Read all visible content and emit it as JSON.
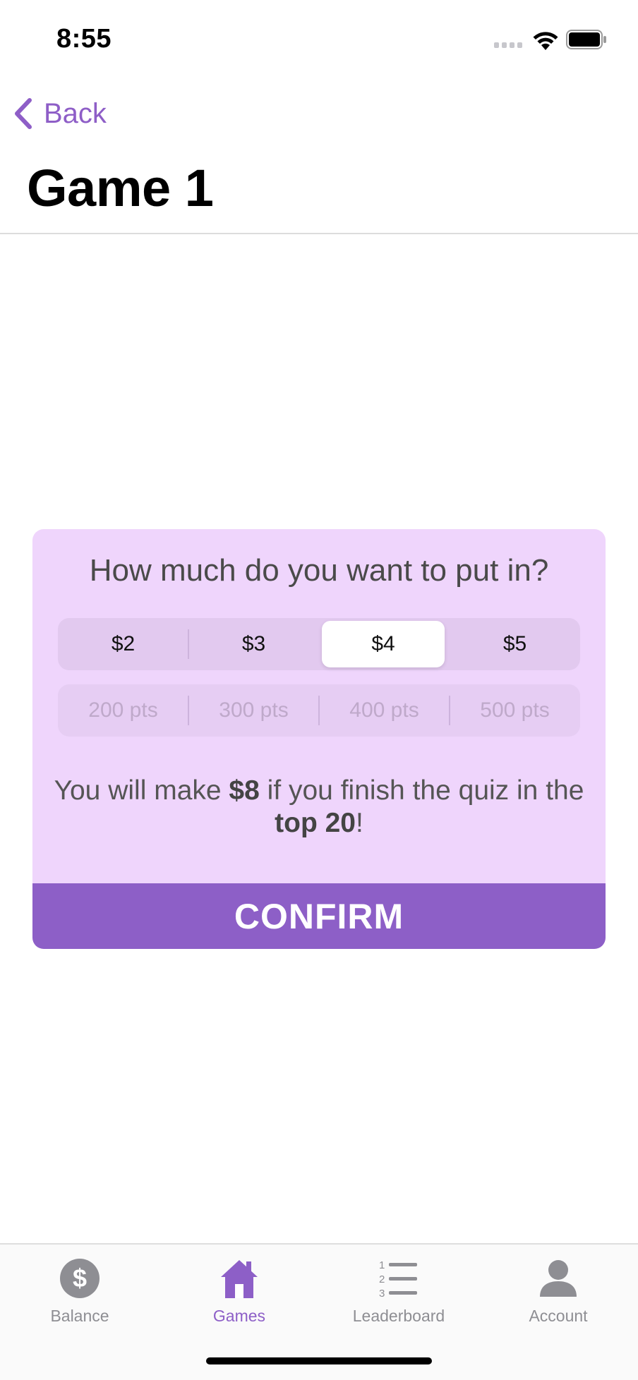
{
  "status_bar": {
    "time": "8:55"
  },
  "nav": {
    "back_label": "Back",
    "title": "Game 1"
  },
  "card": {
    "question": "How much do you want to put in?",
    "amount_options": [
      "$2",
      "$3",
      "$4",
      "$5"
    ],
    "selected_amount_index": 2,
    "points_options": [
      "200 pts",
      "300 pts",
      "400 pts",
      "500 pts"
    ],
    "message_prefix": "You will make ",
    "message_amount": "$8",
    "message_middle": " if you finish the quiz in the ",
    "message_rank": "top 20",
    "message_suffix": "!",
    "confirm_label": "CONFIRM"
  },
  "tab_bar": {
    "items": [
      {
        "label": "Balance",
        "icon": "dollar-icon",
        "active": false
      },
      {
        "label": "Games",
        "icon": "home-icon",
        "active": true
      },
      {
        "label": "Leaderboard",
        "icon": "numbered-list-icon",
        "active": false
      },
      {
        "label": "Account",
        "icon": "person-icon",
        "active": false
      }
    ]
  },
  "colors": {
    "accent": "#8d5fc7",
    "card_background": "#efd5fc",
    "inactive_tab": "#8e8e93"
  }
}
